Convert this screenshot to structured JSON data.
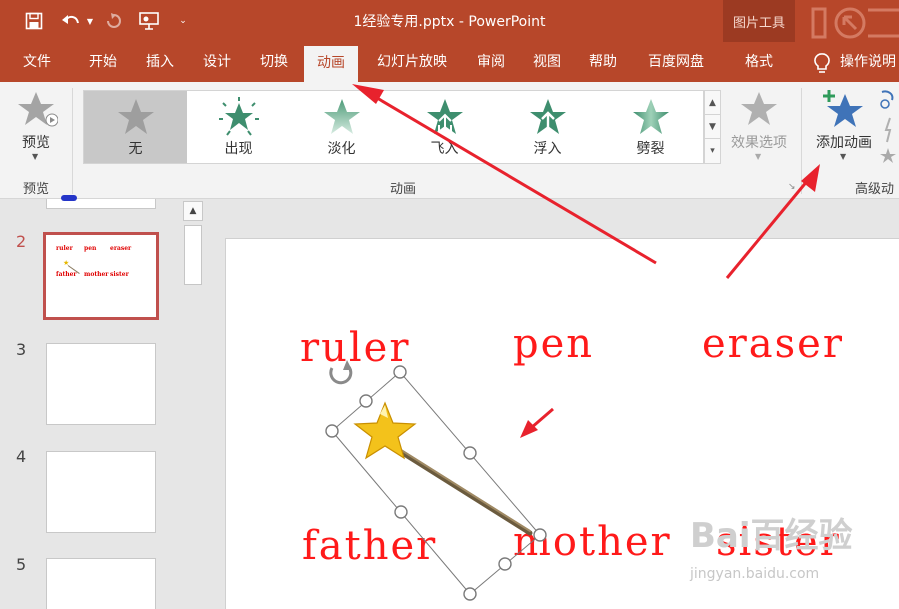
{
  "window": {
    "title": "1经验专用.pptx  -  PowerPoint",
    "contextual_label": "图片工具"
  },
  "quick_access": {
    "save_icon": "save-icon",
    "undo_icon": "undo-icon",
    "redo_icon": "redo-icon",
    "present_icon": "present-from-start-icon",
    "customize_icon": "customize-qat-icon"
  },
  "tabs": [
    {
      "label": "文件"
    },
    {
      "label": "开始"
    },
    {
      "label": "插入"
    },
    {
      "label": "设计"
    },
    {
      "label": "切换"
    },
    {
      "label": "动画"
    },
    {
      "label": "幻灯片放映"
    },
    {
      "label": "审阅"
    },
    {
      "label": "视图"
    },
    {
      "label": "帮助"
    },
    {
      "label": "百度网盘"
    },
    {
      "label": "格式"
    }
  ],
  "active_tab": "动画",
  "tell_me": {
    "label": "操作说明"
  },
  "ribbon": {
    "preview": {
      "label": "预览",
      "group_label": "预览"
    },
    "animation_gallery": {
      "group_label": "动画",
      "items": [
        {
          "label": "无",
          "icon": "star-gray-icon",
          "selected": true
        },
        {
          "label": "出现",
          "icon": "star-burst-green-icon",
          "selected": false
        },
        {
          "label": "淡化",
          "icon": "star-fade-green-icon",
          "selected": false
        },
        {
          "label": "飞入",
          "icon": "star-fly-in-green-icon",
          "selected": false
        },
        {
          "label": "浮入",
          "icon": "star-float-in-green-icon",
          "selected": false
        },
        {
          "label": "劈裂",
          "icon": "star-split-green-icon",
          "selected": false
        }
      ]
    },
    "effect_options": {
      "label": "效果选项"
    },
    "add_animation": {
      "label": "添加动画"
    },
    "advanced_group_label": "高级动"
  },
  "slides_panel": {
    "slide_numbers": [
      "2",
      "3",
      "4",
      "5"
    ],
    "active_slide": "2",
    "thumb_words": [
      "ruler",
      "pen",
      "eraser",
      "father",
      "mother",
      "sister"
    ]
  },
  "slide": {
    "words": [
      "ruler",
      "pen",
      "eraser",
      "father",
      "mother",
      "sister"
    ]
  },
  "watermark": {
    "text": "Bai百经验",
    "url": "jingyan.baidu.com"
  },
  "colors": {
    "accent": "#b7472a",
    "slide_text": "#ff1a1a",
    "annotation_arrow": "#e8222d"
  }
}
